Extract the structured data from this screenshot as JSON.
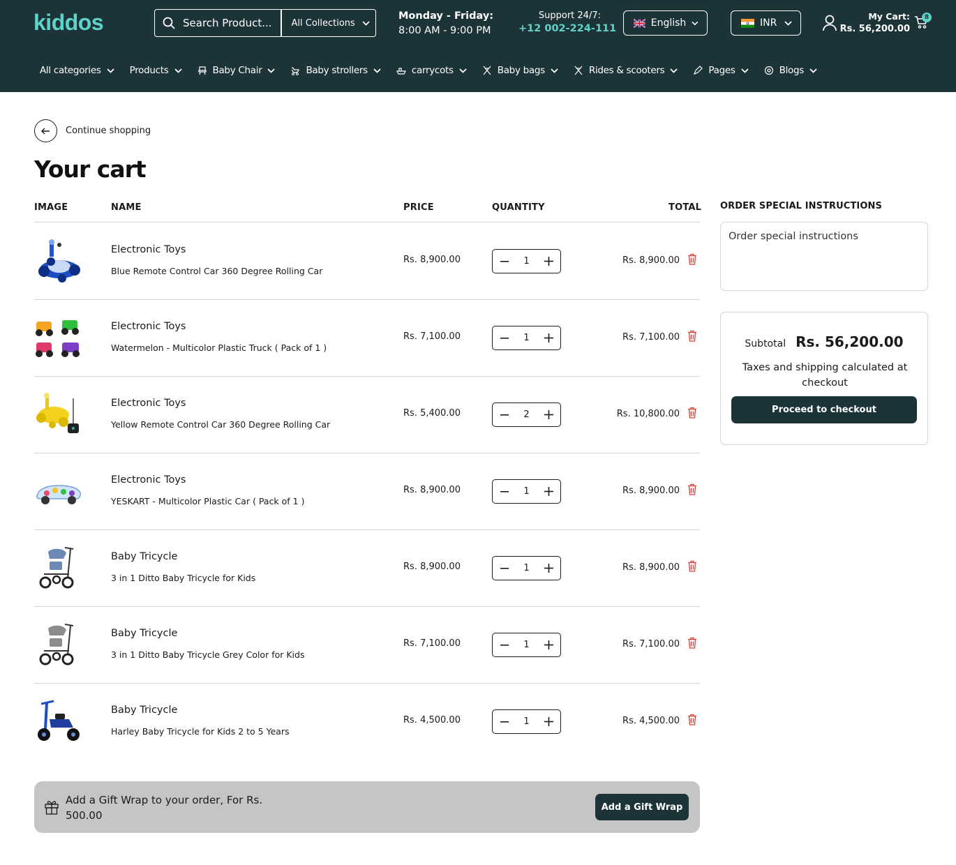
{
  "header": {
    "logo": "kiddos",
    "search_placeholder": "Search Product...",
    "collections": "All Collections",
    "hours_days": "Monday - Friday:",
    "hours_time": "8:00 AM - 9:00 PM",
    "support_label": "Support 24/7:",
    "support_phone": "+12 002-224-111",
    "language": "English",
    "currency": "INR",
    "cart_label": "My Cart:",
    "cart_amount": "Rs. 56,200.00",
    "cart_count": "8"
  },
  "nav": [
    {
      "label": "All categories",
      "icon": "none"
    },
    {
      "label": "Products",
      "icon": "none"
    },
    {
      "label": "Baby Chair",
      "icon": "chair-icon"
    },
    {
      "label": "Baby strollers",
      "icon": "stroller-icon"
    },
    {
      "label": "carrycots",
      "icon": "carrycot-icon"
    },
    {
      "label": "Baby bags",
      "icon": "bag-icon"
    },
    {
      "label": "Rides & scooters",
      "icon": "scooter-icon"
    },
    {
      "label": "Pages",
      "icon": "pen-icon"
    },
    {
      "label": "Blogs",
      "icon": "gear-icon"
    }
  ],
  "page": {
    "continue": "Continue shopping",
    "title": "Your cart"
  },
  "table": {
    "headers": {
      "image": "IMAGE",
      "name": "NAME",
      "price": "PRICE",
      "quantity": "QUANTITY",
      "total": "TOTAL"
    },
    "rows": [
      {
        "category": "Electronic Toys",
        "name": "Blue Remote Control Car 360 Degree Rolling Car",
        "price": "Rs. 8,900.00",
        "qty": "1",
        "total": "Rs. 8,900.00",
        "image": "blue-rc-car"
      },
      {
        "category": "Electronic Toys",
        "name": "Watermelon - Multicolor Plastic Truck ( Pack of 1 )",
        "price": "Rs. 7,100.00",
        "qty": "1",
        "total": "Rs. 7,100.00",
        "image": "multicolor-trucks"
      },
      {
        "category": "Electronic Toys",
        "name": "Yellow Remote Control Car 360 Degree Rolling Car",
        "price": "Rs. 5,400.00",
        "qty": "2",
        "total": "Rs. 10,800.00",
        "image": "yellow-rc-car"
      },
      {
        "category": "Electronic Toys",
        "name": "YESKART - Multicolor Plastic Car ( Pack of 1 )",
        "price": "Rs. 8,900.00",
        "qty": "1",
        "total": "Rs. 8,900.00",
        "image": "transparent-car"
      },
      {
        "category": "Baby Tricycle",
        "name": "3 in 1 Ditto Baby Tricycle for Kids",
        "price": "Rs. 8,900.00",
        "qty": "1",
        "total": "Rs. 8,900.00",
        "image": "blue-tricycle"
      },
      {
        "category": "Baby Tricycle",
        "name": "3 in 1 Ditto Baby Tricycle Grey Color for Kids",
        "price": "Rs. 7,100.00",
        "qty": "1",
        "total": "Rs. 7,100.00",
        "image": "grey-tricycle"
      },
      {
        "category": "Baby Tricycle",
        "name": "Harley Baby Tricycle for Kids 2 to 5 Years",
        "price": "Rs. 4,500.00",
        "qty": "1",
        "total": "Rs. 4,500.00",
        "image": "harley-tricycle"
      }
    ]
  },
  "gift": {
    "text": "Add a Gift Wrap to your order, For Rs. 500.00",
    "button": "Add a Gift Wrap"
  },
  "sidebar": {
    "instructions_title": "ORDER SPECIAL INSTRUCTIONS",
    "instructions_placeholder": "Order special instructions",
    "subtotal_label": "Subtotal",
    "subtotal_value": "Rs. 56,200.00",
    "tax_note": "Taxes and shipping calculated at checkout",
    "checkout": "Proceed to checkout"
  },
  "colors": {
    "brand_dark": "#1c3338",
    "accent_teal": "#5fd3c9",
    "trash_red": "#e53935"
  }
}
